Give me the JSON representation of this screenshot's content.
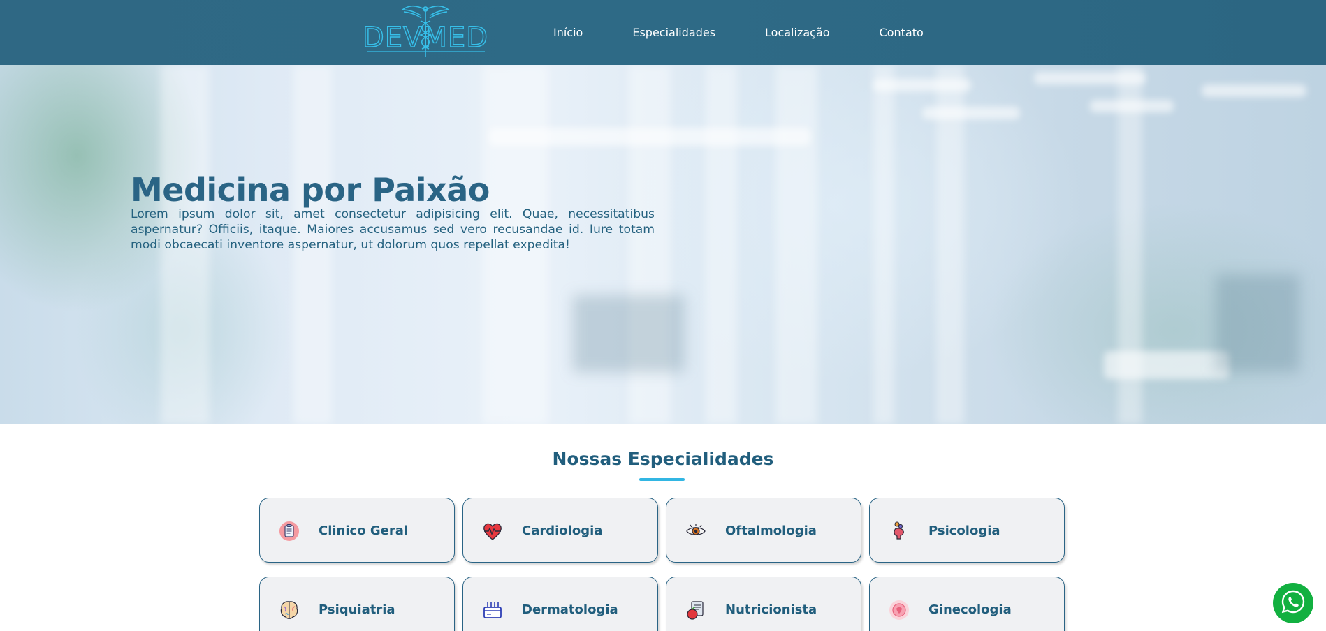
{
  "header": {
    "logo_text": "DEVMED",
    "nav": [
      {
        "label": "Início"
      },
      {
        "label": "Especialidades"
      },
      {
        "label": "Localização"
      },
      {
        "label": "Contato"
      }
    ]
  },
  "hero": {
    "title": "Medicina por Paixão",
    "text": "Lorem ipsum dolor sit, amet consectetur adipisicing elit. Quae, necessitatibus aspernatur? Officiis, itaque. Maiores accusamus sed vero recusandae id. Iure totam modi obcaecati inventore aspernatur, ut dolorum quos repellat expedita!"
  },
  "specialties": {
    "title": "Nossas Especialidades",
    "items": [
      {
        "label": "Clinico Geral",
        "icon": "clipboard-icon"
      },
      {
        "label": "Cardiologia",
        "icon": "heart-icon"
      },
      {
        "label": "Oftalmologia",
        "icon": "eye-icon"
      },
      {
        "label": "Psicologia",
        "icon": "head-icon"
      },
      {
        "label": "Psiquiatria",
        "icon": "brain-icon"
      },
      {
        "label": "Dermatologia",
        "icon": "skin-icon"
      },
      {
        "label": "Nutricionista",
        "icon": "nutrition-icon"
      },
      {
        "label": "Ginecologia",
        "icon": "uterus-icon"
      }
    ]
  },
  "colors": {
    "header_bg": "#2e6a86",
    "primary_text": "#215e7d",
    "accent": "#32b6e3",
    "card_bg": "#f0f1f3",
    "whatsapp": "#12b040"
  }
}
